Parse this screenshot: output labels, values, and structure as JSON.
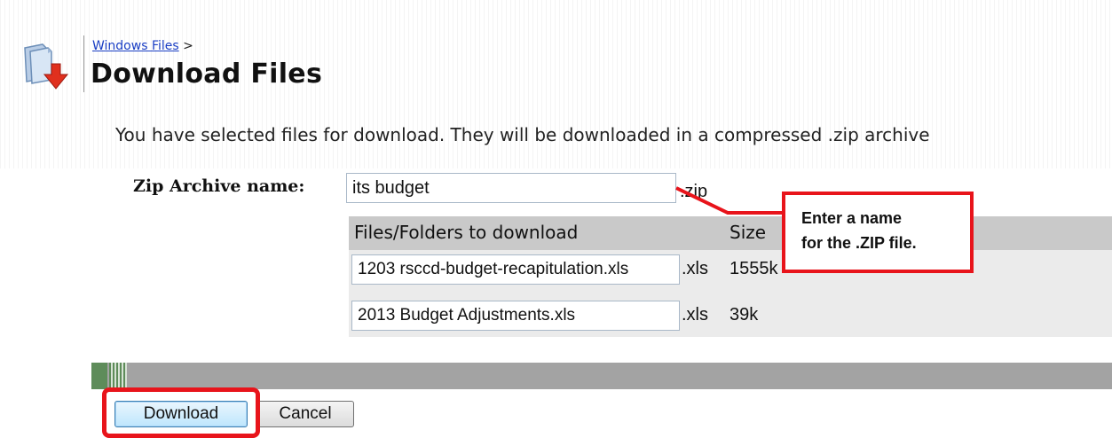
{
  "breadcrumb": {
    "link": "Windows Files",
    "separator": ">"
  },
  "page": {
    "title": "Download Files"
  },
  "description": "You have selected files for download. They will be downloaded in a compressed .zip archive",
  "zip": {
    "label": "Zip Archive name:",
    "value": "its budget",
    "extension": ".zip"
  },
  "table": {
    "headers": {
      "files": "Files/Folders to download",
      "size": "Size"
    },
    "rows": [
      {
        "name": "1203 rsccd-budget-recapitulation.xls",
        "extension": ".xls",
        "size": "1555k"
      },
      {
        "name": "2013 Budget Adjustments.xls",
        "extension": ".xls",
        "size": "39k"
      }
    ]
  },
  "callout": {
    "line1": "Enter a name",
    "line2": "for the .ZIP file."
  },
  "buttons": {
    "download": "Download",
    "cancel": "Cancel"
  },
  "colors": {
    "highlight": "#e8141b",
    "link": "#1a3ec4",
    "separator_accent": "#5e8c5a"
  },
  "icons": {
    "page_icon": "file-download-icon"
  }
}
